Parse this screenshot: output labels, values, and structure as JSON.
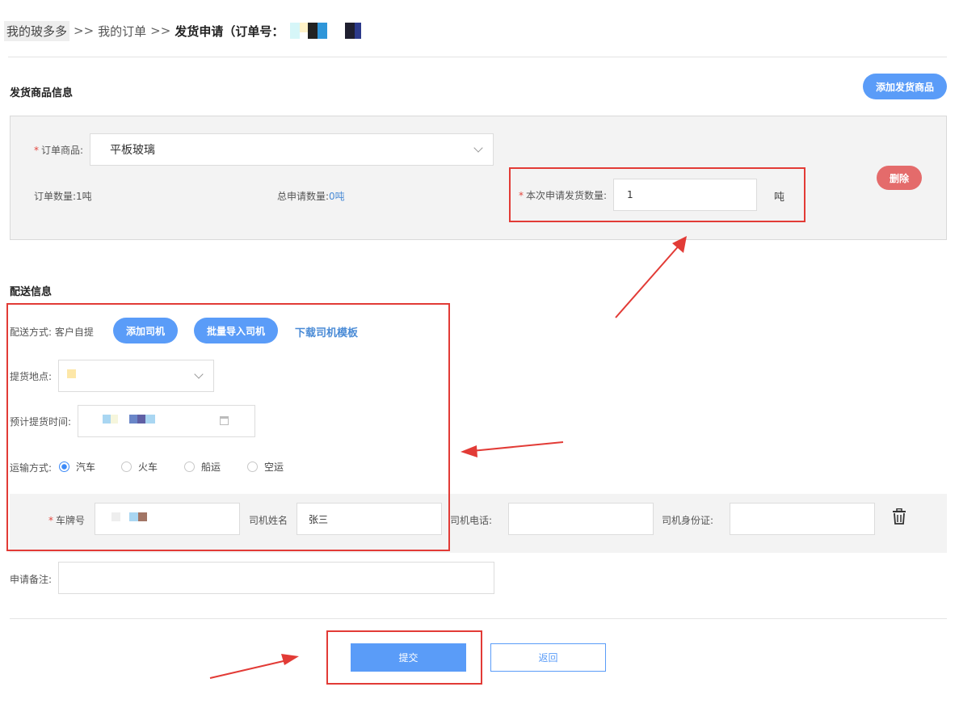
{
  "breadcrumb": {
    "home": "我的玻多多",
    "sep": ">>",
    "orders": "我的订单",
    "current": "发货申请（订单号："
  },
  "goods_section": {
    "title": "发货商品信息",
    "add_button": "添加发货商品",
    "product_label": "订单商品:",
    "product_value": "平板玻璃",
    "order_qty_label": "订单数量:",
    "order_qty_value": "1吨",
    "total_apply_label": "总申请数量:",
    "total_apply_value": "0吨",
    "apply_qty_label": "本次申请发货数量:",
    "apply_qty_value": "1",
    "unit": "吨",
    "delete_button": "删除"
  },
  "delivery_section": {
    "title": "配送信息",
    "method_label": "配送方式:",
    "method_value": "客户自提",
    "add_driver_button": "添加司机",
    "batch_import_button": "批量导入司机",
    "download_template_link": "下载司机模板",
    "pickup_label": "提货地点:",
    "time_label": "预计提货时间:",
    "transport_label": "运输方式:",
    "transport_options": [
      "汽车",
      "火车",
      "船运",
      "空运"
    ],
    "transport_selected": "汽车",
    "plate_label": "车牌号",
    "driver_name_label": "司机姓名",
    "driver_name_value": "张三",
    "driver_phone_label": "司机电话:",
    "driver_id_label": "司机身份证:",
    "remark_label": "申请备注:"
  },
  "actions": {
    "submit": "提交",
    "back": "返回"
  },
  "colors": {
    "primary": "#5a9cf8",
    "danger": "#e46b6b",
    "highlight": "#e23b36"
  },
  "icons": {
    "dropdown": "chevron-down-icon",
    "calendar": "calendar-icon",
    "delete": "trash-icon"
  }
}
